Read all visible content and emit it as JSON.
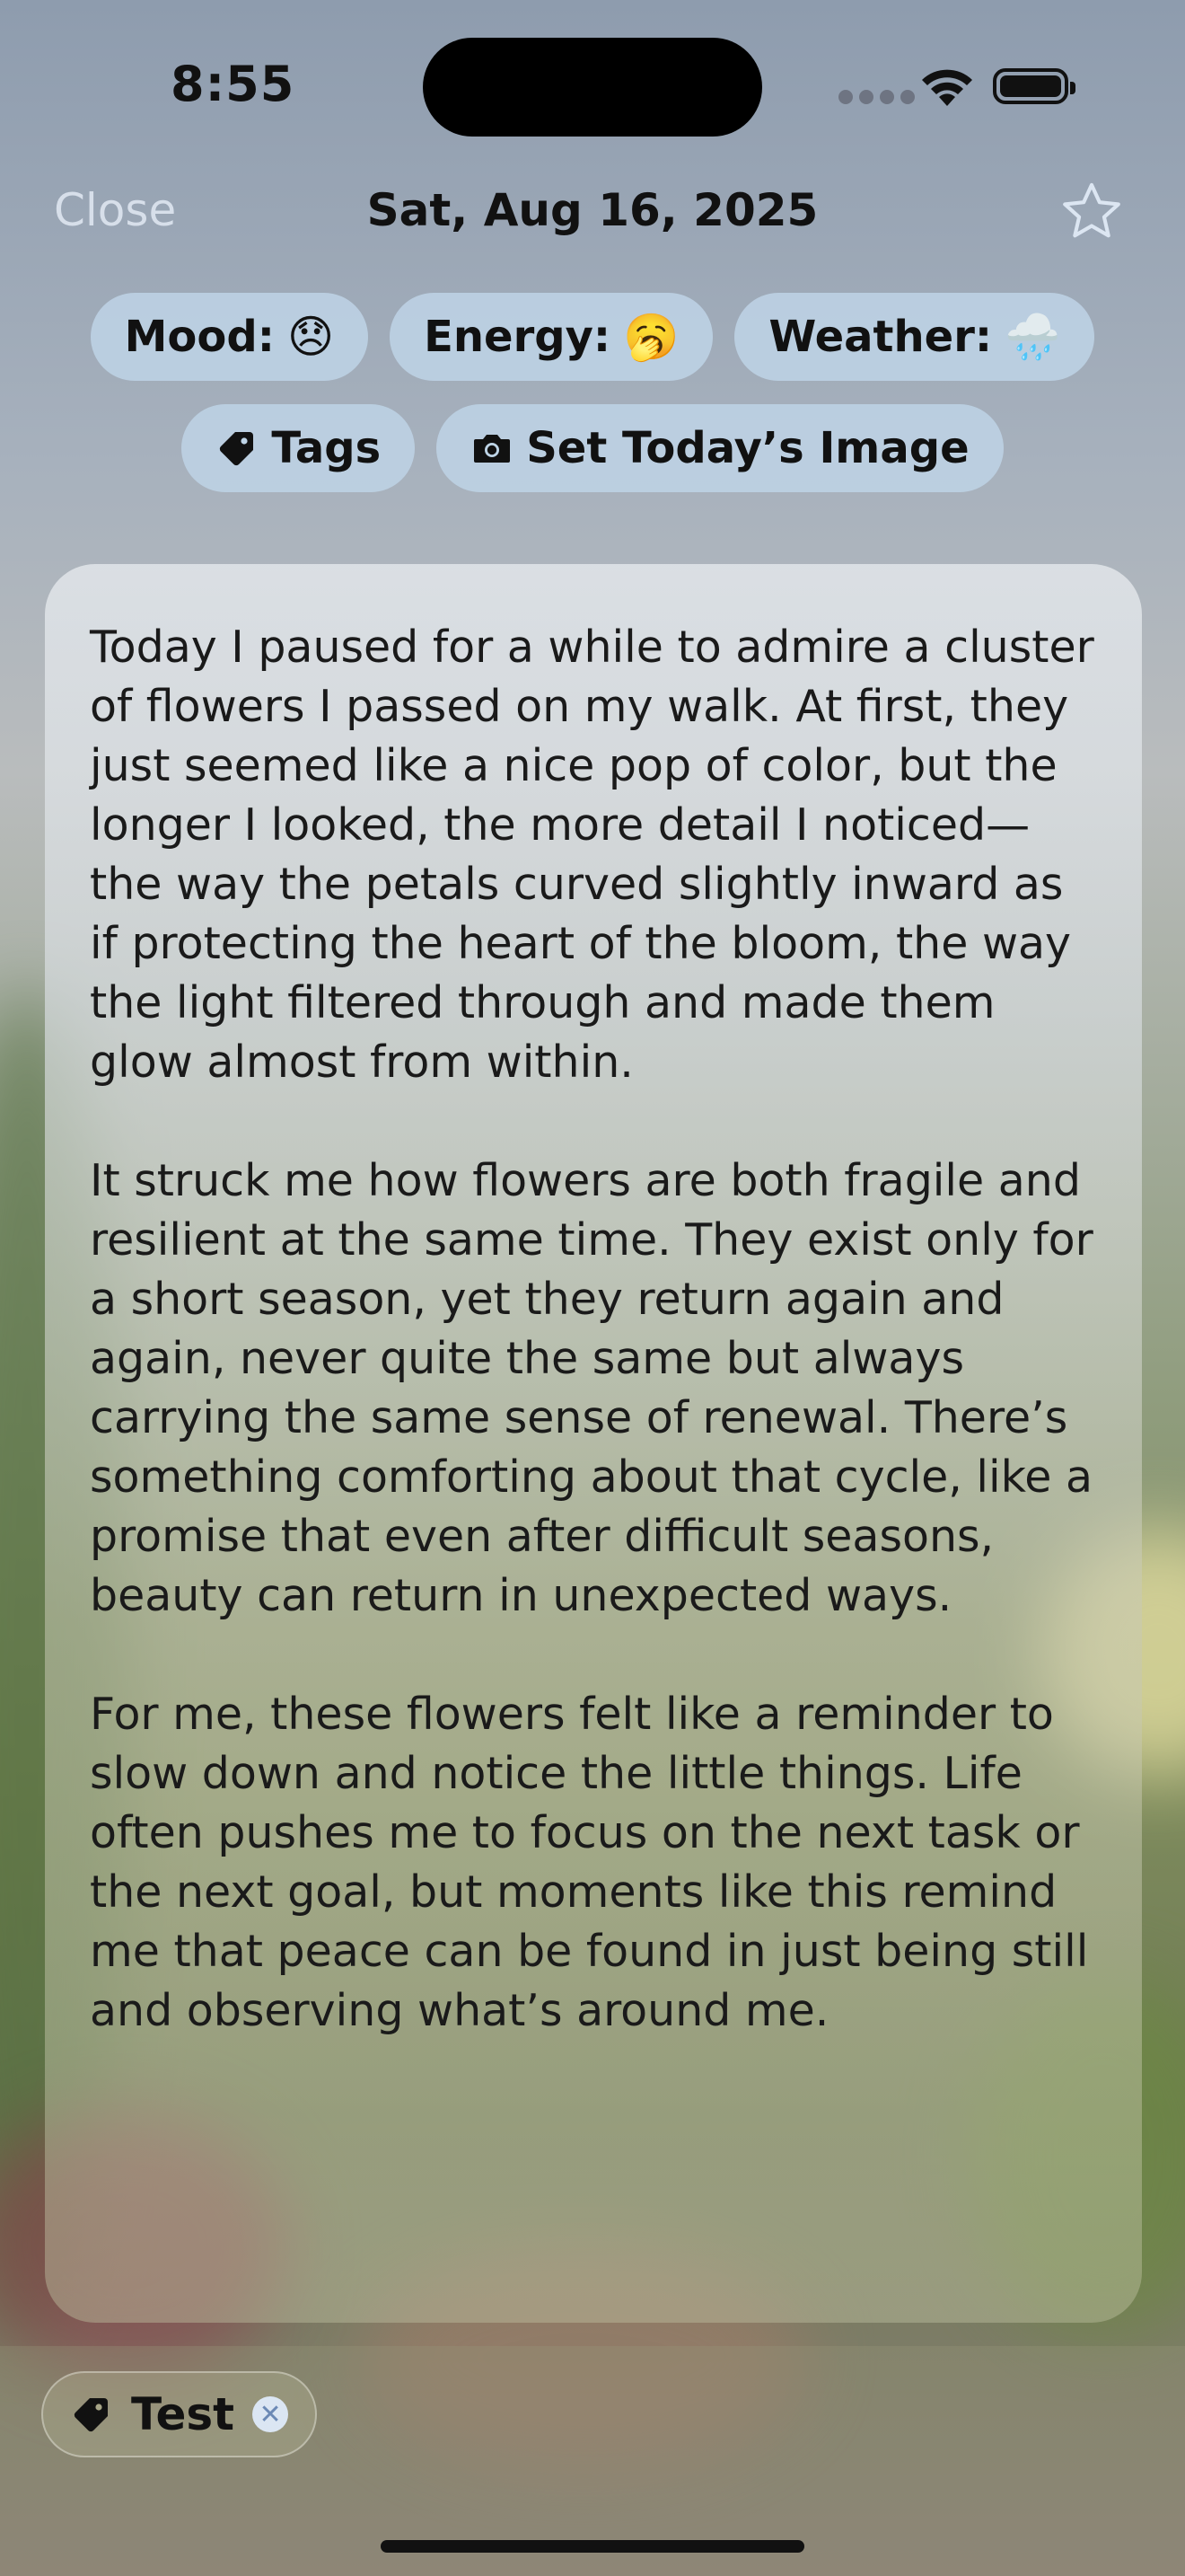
{
  "status_bar": {
    "time": "8:55"
  },
  "nav": {
    "close_label": "Close",
    "title": "Sat, Aug 16, 2025",
    "favorite_icon": "star-icon"
  },
  "chips": {
    "mood_label": "Mood:",
    "mood_emoji": "😞",
    "energy_label": "Energy:",
    "energy_emoji": "🥱",
    "weather_label": "Weather:",
    "weather_emoji": "🌧️",
    "tags_label": "Tags",
    "image_label": "Set Today’s Image"
  },
  "entry": {
    "paragraphs": [
      "Today I paused for a while to admire a cluster of flowers I passed on my walk. At first, they just seemed like a nice pop of color, but the longer I looked, the more detail I noticed—the way the petals curved slightly inward as if protecting the heart of the bloom, the way the light filtered through and made them glow almost from within.",
      "It struck me how flowers are both fragile and resilient at the same time. They exist only for a short season, yet they return again and again, never quite the same but always carrying the same sense of renewal. There’s something comforting about that cycle, like a promise that even after difficult seasons, beauty can return in unexpected ways.",
      "For me, these flowers felt like a reminder to slow down and notice the little things. Life often pushes me to focus on the next task or the next goal, but moments like this remind me that peace can be found in just being still and observing what’s around me."
    ]
  },
  "tags": [
    {
      "label": "Test"
    }
  ],
  "colors": {
    "chip_bg": "#bed4e6",
    "close_text": "#d7dfea"
  }
}
